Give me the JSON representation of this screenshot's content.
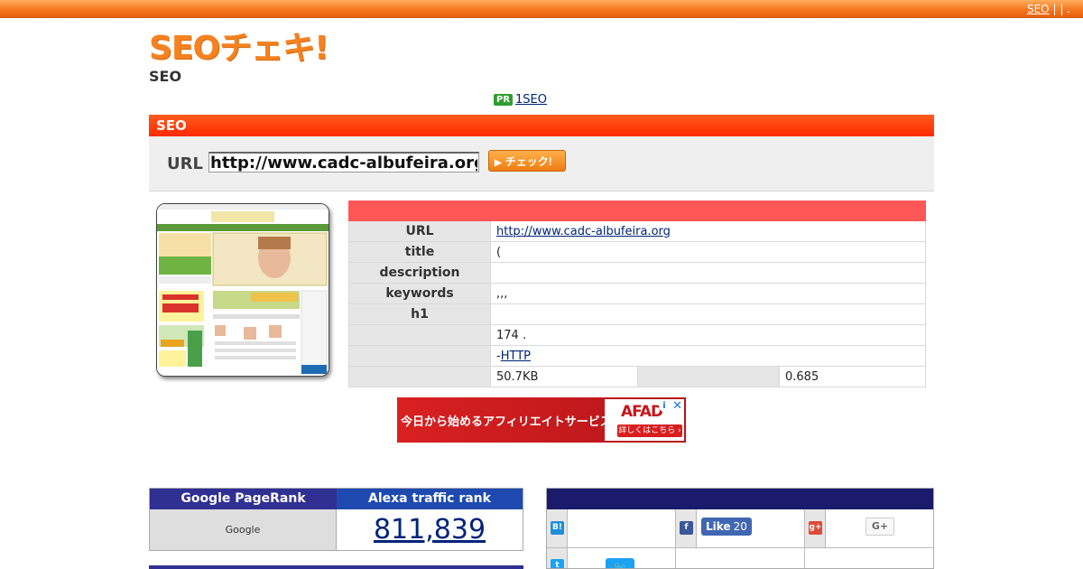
{
  "topbar": {
    "link": "SEO",
    "separators": "| | ."
  },
  "brand": {
    "logo_text": "SEOチェキ!",
    "subtitle": "SEO"
  },
  "pr": {
    "badge": "PR",
    "link": "1SEO"
  },
  "seo_section": {
    "header": "SEO",
    "url_label": "URL",
    "url_value": "http://www.cadc-albufeira.org",
    "check_button": "チェック!"
  },
  "info_table": {
    "rows": [
      {
        "label": "URL",
        "value": "http://www.cadc-albufeira.org"
      },
      {
        "label": "title",
        "value": "("
      },
      {
        "label": "description",
        "value": ""
      },
      {
        "label": "keywords",
        "value": ",,,"
      },
      {
        "label": "h1",
        "value": ""
      },
      {
        "label": "",
        "value": "174 ."
      },
      {
        "label": "",
        "prefix": "-",
        "link": "HTTP"
      },
      {
        "label": "",
        "value": "50.7KB",
        "value2": "0.685"
      }
    ]
  },
  "ad": {
    "text": "今日から始めるアフィリエイトサービス",
    "brand": "AFAD",
    "cta": "詳しくはこちら ›",
    "info": "i",
    "close": "✕"
  },
  "ranks": {
    "pagerank_title": "Google PageRank",
    "alexa_title": "Alexa traffic rank",
    "pagerank_value": "Google",
    "alexa_value": "811,839"
  },
  "social": {
    "hatena_icon": "B!",
    "facebook_icon": "f",
    "gplus_icon": "g+",
    "twitter_icon": "t",
    "fb_like": "Like",
    "fb_count": "20",
    "gplus_button": "G+"
  }
}
